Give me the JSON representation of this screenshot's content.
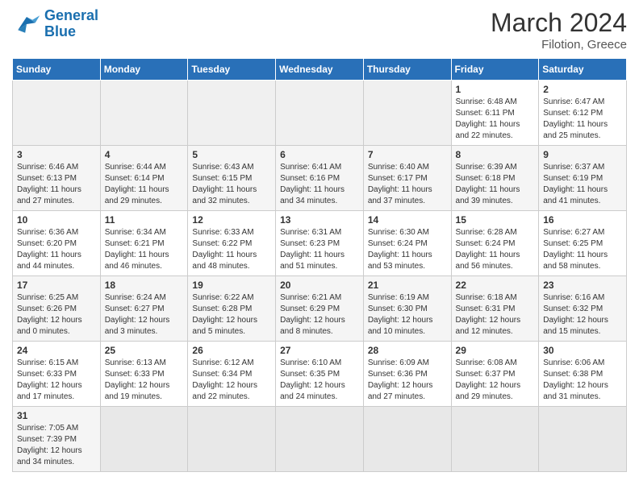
{
  "header": {
    "logo_general": "General",
    "logo_blue": "Blue",
    "month_title": "March 2024",
    "subtitle": "Filotion, Greece"
  },
  "days_of_week": [
    "Sunday",
    "Monday",
    "Tuesday",
    "Wednesday",
    "Thursday",
    "Friday",
    "Saturday"
  ],
  "weeks": [
    {
      "days": [
        {
          "num": "",
          "info": "",
          "empty": true
        },
        {
          "num": "",
          "info": "",
          "empty": true
        },
        {
          "num": "",
          "info": "",
          "empty": true
        },
        {
          "num": "",
          "info": "",
          "empty": true
        },
        {
          "num": "",
          "info": "",
          "empty": true
        },
        {
          "num": "1",
          "info": "Sunrise: 6:48 AM\nSunset: 6:11 PM\nDaylight: 11 hours\nand 22 minutes."
        },
        {
          "num": "2",
          "info": "Sunrise: 6:47 AM\nSunset: 6:12 PM\nDaylight: 11 hours\nand 25 minutes."
        }
      ]
    },
    {
      "days": [
        {
          "num": "3",
          "info": "Sunrise: 6:46 AM\nSunset: 6:13 PM\nDaylight: 11 hours\nand 27 minutes."
        },
        {
          "num": "4",
          "info": "Sunrise: 6:44 AM\nSunset: 6:14 PM\nDaylight: 11 hours\nand 29 minutes."
        },
        {
          "num": "5",
          "info": "Sunrise: 6:43 AM\nSunset: 6:15 PM\nDaylight: 11 hours\nand 32 minutes."
        },
        {
          "num": "6",
          "info": "Sunrise: 6:41 AM\nSunset: 6:16 PM\nDaylight: 11 hours\nand 34 minutes."
        },
        {
          "num": "7",
          "info": "Sunrise: 6:40 AM\nSunset: 6:17 PM\nDaylight: 11 hours\nand 37 minutes."
        },
        {
          "num": "8",
          "info": "Sunrise: 6:39 AM\nSunset: 6:18 PM\nDaylight: 11 hours\nand 39 minutes."
        },
        {
          "num": "9",
          "info": "Sunrise: 6:37 AM\nSunset: 6:19 PM\nDaylight: 11 hours\nand 41 minutes."
        }
      ]
    },
    {
      "days": [
        {
          "num": "10",
          "info": "Sunrise: 6:36 AM\nSunset: 6:20 PM\nDaylight: 11 hours\nand 44 minutes."
        },
        {
          "num": "11",
          "info": "Sunrise: 6:34 AM\nSunset: 6:21 PM\nDaylight: 11 hours\nand 46 minutes."
        },
        {
          "num": "12",
          "info": "Sunrise: 6:33 AM\nSunset: 6:22 PM\nDaylight: 11 hours\nand 48 minutes."
        },
        {
          "num": "13",
          "info": "Sunrise: 6:31 AM\nSunset: 6:23 PM\nDaylight: 11 hours\nand 51 minutes."
        },
        {
          "num": "14",
          "info": "Sunrise: 6:30 AM\nSunset: 6:24 PM\nDaylight: 11 hours\nand 53 minutes."
        },
        {
          "num": "15",
          "info": "Sunrise: 6:28 AM\nSunset: 6:24 PM\nDaylight: 11 hours\nand 56 minutes."
        },
        {
          "num": "16",
          "info": "Sunrise: 6:27 AM\nSunset: 6:25 PM\nDaylight: 11 hours\nand 58 minutes."
        }
      ]
    },
    {
      "days": [
        {
          "num": "17",
          "info": "Sunrise: 6:25 AM\nSunset: 6:26 PM\nDaylight: 12 hours\nand 0 minutes."
        },
        {
          "num": "18",
          "info": "Sunrise: 6:24 AM\nSunset: 6:27 PM\nDaylight: 12 hours\nand 3 minutes."
        },
        {
          "num": "19",
          "info": "Sunrise: 6:22 AM\nSunset: 6:28 PM\nDaylight: 12 hours\nand 5 minutes."
        },
        {
          "num": "20",
          "info": "Sunrise: 6:21 AM\nSunset: 6:29 PM\nDaylight: 12 hours\nand 8 minutes."
        },
        {
          "num": "21",
          "info": "Sunrise: 6:19 AM\nSunset: 6:30 PM\nDaylight: 12 hours\nand 10 minutes."
        },
        {
          "num": "22",
          "info": "Sunrise: 6:18 AM\nSunset: 6:31 PM\nDaylight: 12 hours\nand 12 minutes."
        },
        {
          "num": "23",
          "info": "Sunrise: 6:16 AM\nSunset: 6:32 PM\nDaylight: 12 hours\nand 15 minutes."
        }
      ]
    },
    {
      "days": [
        {
          "num": "24",
          "info": "Sunrise: 6:15 AM\nSunset: 6:33 PM\nDaylight: 12 hours\nand 17 minutes."
        },
        {
          "num": "25",
          "info": "Sunrise: 6:13 AM\nSunset: 6:33 PM\nDaylight: 12 hours\nand 19 minutes."
        },
        {
          "num": "26",
          "info": "Sunrise: 6:12 AM\nSunset: 6:34 PM\nDaylight: 12 hours\nand 22 minutes."
        },
        {
          "num": "27",
          "info": "Sunrise: 6:10 AM\nSunset: 6:35 PM\nDaylight: 12 hours\nand 24 minutes."
        },
        {
          "num": "28",
          "info": "Sunrise: 6:09 AM\nSunset: 6:36 PM\nDaylight: 12 hours\nand 27 minutes."
        },
        {
          "num": "29",
          "info": "Sunrise: 6:08 AM\nSunset: 6:37 PM\nDaylight: 12 hours\nand 29 minutes."
        },
        {
          "num": "30",
          "info": "Sunrise: 6:06 AM\nSunset: 6:38 PM\nDaylight: 12 hours\nand 31 minutes."
        }
      ]
    },
    {
      "days": [
        {
          "num": "31",
          "info": "Sunrise: 7:05 AM\nSunset: 7:39 PM\nDaylight: 12 hours\nand 34 minutes."
        },
        {
          "num": "",
          "info": "",
          "empty": true
        },
        {
          "num": "",
          "info": "",
          "empty": true
        },
        {
          "num": "",
          "info": "",
          "empty": true
        },
        {
          "num": "",
          "info": "",
          "empty": true
        },
        {
          "num": "",
          "info": "",
          "empty": true
        },
        {
          "num": "",
          "info": "",
          "empty": true
        }
      ]
    }
  ]
}
